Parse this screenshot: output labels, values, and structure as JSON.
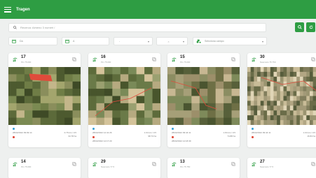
{
  "app": {
    "title": "Tragen"
  },
  "search": {
    "placeholder": "Recerca: Almeno 3 numeri /"
  },
  "filters": {
    "date_from": "Da",
    "date_to": "A",
    "type_value": "-",
    "field_value": "Seleziona campo"
  },
  "colors": {
    "brand": "#2e9d43",
    "accent_blue": "#3ba1d6",
    "accent_red": "#e04b3b"
  },
  "cards": [
    {
      "number": "17",
      "subtitle": "Pin 75.000",
      "line1_left": "28/02/2022 09:09:14",
      "line1_right": "0.76 km / 0.5",
      "line2_right": "34.78 ha",
      "line3_left": ""
    },
    {
      "number": "16",
      "subtitle": "Pin 75.000",
      "line1_left": "28/02/2022 14:41:26",
      "line1_right": "1.04 km / 0.5",
      "line2_right": "98.73 ha",
      "line3_left": "28/02/2022 14:17:20"
    },
    {
      "number": "15",
      "subtitle": "Pin 75.000",
      "line1_left": "28/02/2022 09:44:11",
      "line1_right": "1.84 km / 0.5",
      "line2_right": "74.88 ha",
      "line3_left": "28/02/2022 14:18:39"
    },
    {
      "number": "30",
      "subtitle": "Nascosto 75.750",
      "line1_left": "28/02/2022 09:44:11",
      "line1_right": "1.04 km / 0.5",
      "line2_right": "16.84 ha",
      "line3_left": ""
    },
    {
      "number": "14",
      "subtitle": "Pin 75.000"
    },
    {
      "number": "29",
      "subtitle": "Nascosto 77.5"
    },
    {
      "number": "13",
      "subtitle": "Pin 75.750"
    },
    {
      "number": "27",
      "subtitle": "Nascosto 77.5"
    }
  ]
}
